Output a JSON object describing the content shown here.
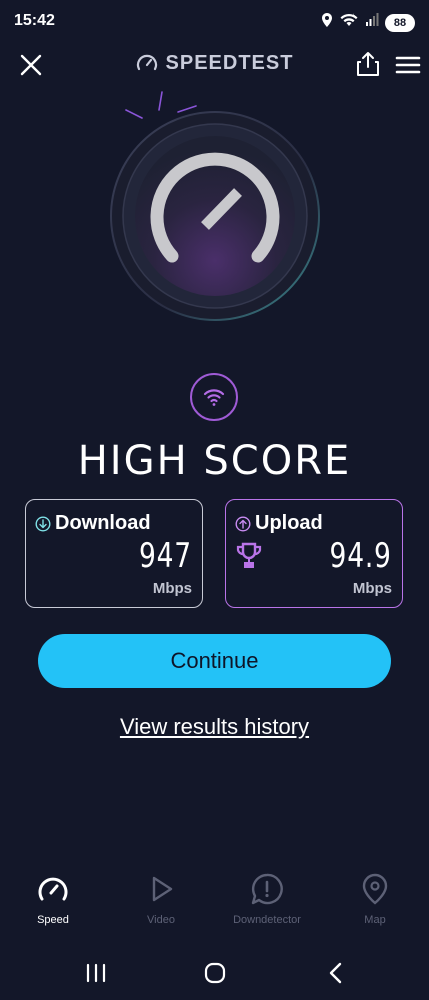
{
  "status_bar": {
    "time": "15:42",
    "battery": "88",
    "icons": [
      "location-icon",
      "wifi-icon",
      "signal-icon",
      "battery-icon"
    ]
  },
  "header": {
    "brand": "SPEEDTEST",
    "close_icon": "close-icon",
    "share_icon": "share-icon",
    "menu_icon": "menu-icon"
  },
  "result": {
    "connection_icon": "wifi-icon",
    "headline": "HIGH SCORE",
    "download": {
      "label": "Download",
      "value": "947",
      "unit": "Mbps",
      "icon": "arrow-down-circle-icon"
    },
    "upload": {
      "label": "Upload",
      "value": "94.9",
      "unit": "Mbps",
      "icon": "arrow-up-circle-icon",
      "badge_icon": "trophy-icon"
    }
  },
  "actions": {
    "continue_label": "Continue",
    "history_label": "View results history"
  },
  "tabs": [
    {
      "label": "Speed",
      "icon": "speedometer-icon",
      "active": true
    },
    {
      "label": "Video",
      "icon": "play-icon",
      "active": false
    },
    {
      "label": "Downdetector",
      "icon": "alert-icon",
      "active": false
    },
    {
      "label": "Map",
      "icon": "map-pin-icon",
      "active": false
    }
  ],
  "colors": {
    "background": "#131729",
    "accent_cyan": "#23c2f7",
    "accent_purple": "#b974e8",
    "text_muted": "#5d6176"
  }
}
